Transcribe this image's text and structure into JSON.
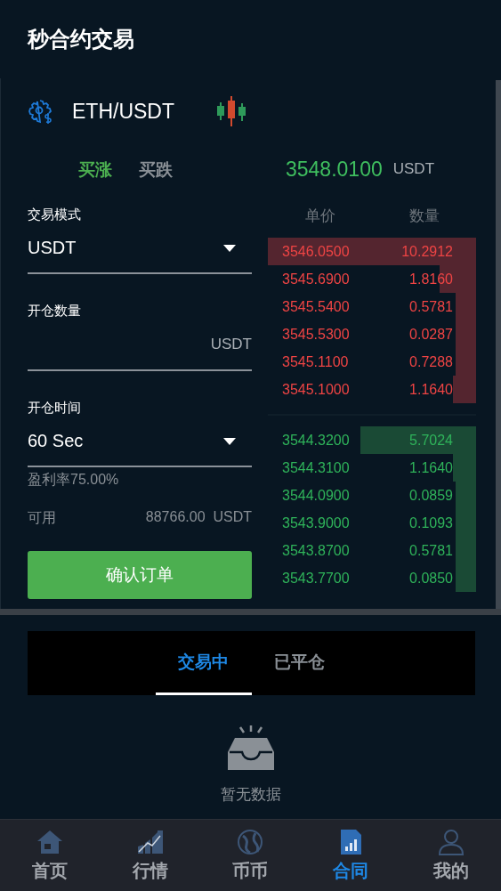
{
  "header": {
    "title": "秒合约交易"
  },
  "pair": {
    "symbol": "ETH/USDT"
  },
  "direction_tabs": [
    {
      "label": "买涨",
      "selected": true
    },
    {
      "label": "买跌",
      "selected": false
    }
  ],
  "price": {
    "value": "3548.0100",
    "unit": "USDT"
  },
  "form": {
    "mode_label": "交易模式",
    "mode_value": "USDT",
    "amount_label": "开仓数量",
    "amount_unit": "USDT",
    "time_label": "开仓时间",
    "time_value": "60 Sec",
    "profit_rate": "盈利率75.00%",
    "available_label": "可用",
    "available_value": "88766.00",
    "available_unit": "USDT",
    "submit": "确认订单"
  },
  "order_book": {
    "columns": [
      "单价",
      "数量"
    ],
    "asks": [
      {
        "price": "3546.0500",
        "amount": "10.2912"
      },
      {
        "price": "3545.6900",
        "amount": "1.8160"
      },
      {
        "price": "3545.5400",
        "amount": "0.5781"
      },
      {
        "price": "3545.5300",
        "amount": "0.0287"
      },
      {
        "price": "3545.1100",
        "amount": "0.7288"
      },
      {
        "price": "3545.1000",
        "amount": "1.1640"
      }
    ],
    "bids": [
      {
        "price": "3544.3200",
        "amount": "5.7024"
      },
      {
        "price": "3544.3100",
        "amount": "1.1640"
      },
      {
        "price": "3544.0900",
        "amount": "0.0859"
      },
      {
        "price": "3543.9000",
        "amount": "0.1093"
      },
      {
        "price": "3543.8700",
        "amount": "0.5781"
      },
      {
        "price": "3543.7700",
        "amount": "0.0850"
      }
    ]
  },
  "order_tabs": [
    {
      "label": "交易中",
      "selected": true
    },
    {
      "label": "已平仓",
      "selected": false
    }
  ],
  "empty_state": {
    "text": "暂无数据"
  },
  "bottom_nav": [
    {
      "label": "首页",
      "kind": "home",
      "selected": false
    },
    {
      "label": "行情",
      "kind": "market",
      "selected": false
    },
    {
      "label": "币币",
      "kind": "coin",
      "selected": false
    },
    {
      "label": "合同",
      "kind": "contract",
      "selected": true
    },
    {
      "label": "我的",
      "kind": "profile",
      "selected": false
    }
  ]
}
